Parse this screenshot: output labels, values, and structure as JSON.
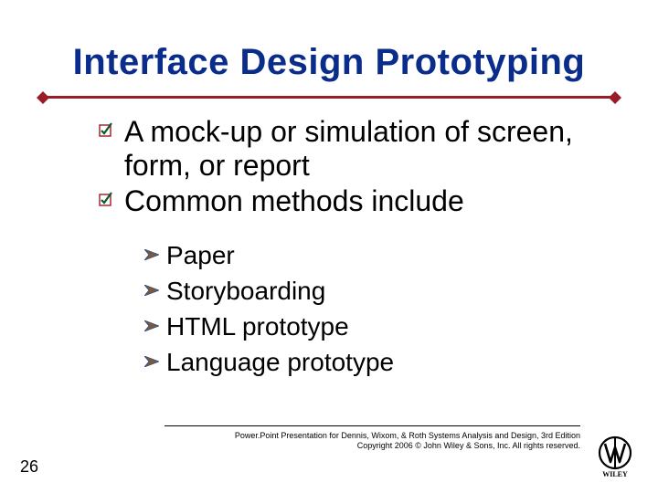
{
  "slide": {
    "title": "Interface Design Prototyping",
    "page_number": "26"
  },
  "bullets_level1": [
    "A mock-up or simulation of screen, form, or report",
    "Common methods include"
  ],
  "bullets_level2": [
    "Paper",
    "Storyboarding",
    "HTML prototype",
    "Language prototype"
  ],
  "footer": {
    "line1": "Power.Point Presentation for Dennis, Wixom, & Roth Systems Analysis and Design, 3rd Edition",
    "line2": "Copyright 2006 © John Wiley & Sons, Inc.  All rights reserved."
  },
  "colors": {
    "title": "#0a2c8a",
    "accent": "#9a1c28",
    "bullet2_fill": "#7a5a3a",
    "bullet2_stroke": "#2a4a8a"
  }
}
